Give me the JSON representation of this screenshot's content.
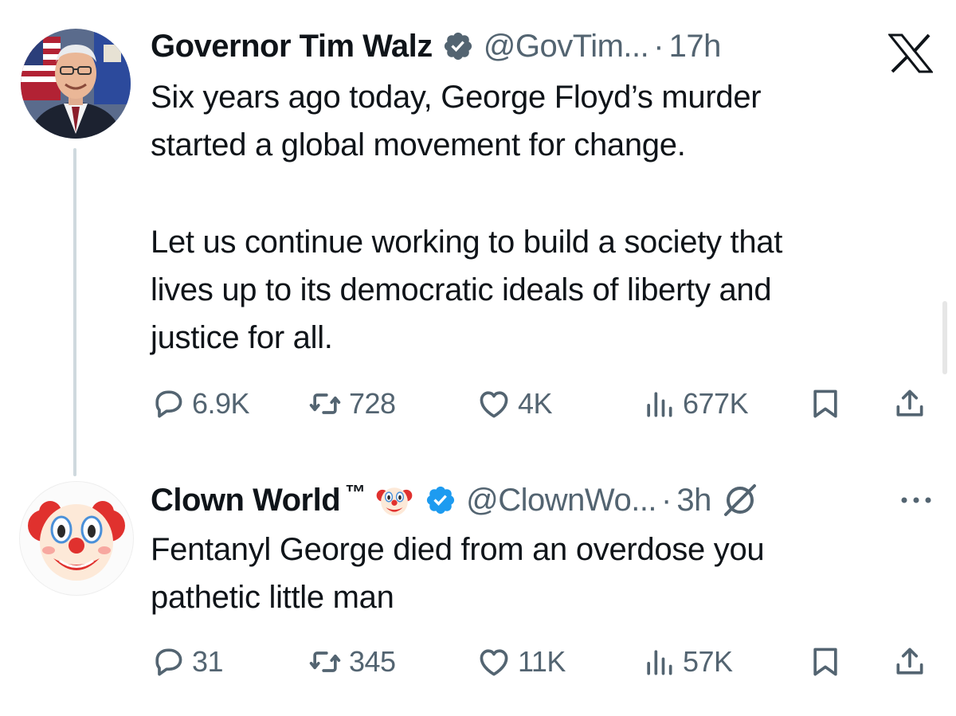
{
  "tweet1": {
    "author_name": "Governor Tim Walz",
    "handle": "@GovTim...",
    "separator": "·",
    "time": "17h",
    "text_lines": [
      "Six years ago today, George Floyd’s murder",
      "started a global movement for change.",
      "Let us continue working to build a society that",
      "lives up to its democratic ideals of liberty and",
      "justice for all."
    ],
    "replies": "6.9K",
    "reposts": "728",
    "likes": "4K",
    "views": "677K"
  },
  "tweet2": {
    "author_name": "Clown World",
    "tm": "™",
    "handle": "@ClownWo...",
    "separator": "·",
    "time": "3h",
    "text_lines": [
      "Fentanyl George died from an overdose you",
      "pathetic little man"
    ],
    "replies": "31",
    "reposts": "345",
    "likes": "11K",
    "views": "57K"
  },
  "icons": {
    "verified": "verified-badge-icon",
    "platform": "x-logo-icon",
    "reply": "reply-icon",
    "repost": "repost-icon",
    "like": "heart-icon",
    "views": "views-icon",
    "bookmark": "bookmark-icon",
    "share": "share-icon",
    "grok": "grok-icon",
    "more": "more-icon",
    "clown": "clown-face-emoji"
  },
  "colors": {
    "text": "#0f1419",
    "secondary": "#536471",
    "verified": "#1d9bf0",
    "thread_line": "#cfd9de"
  }
}
